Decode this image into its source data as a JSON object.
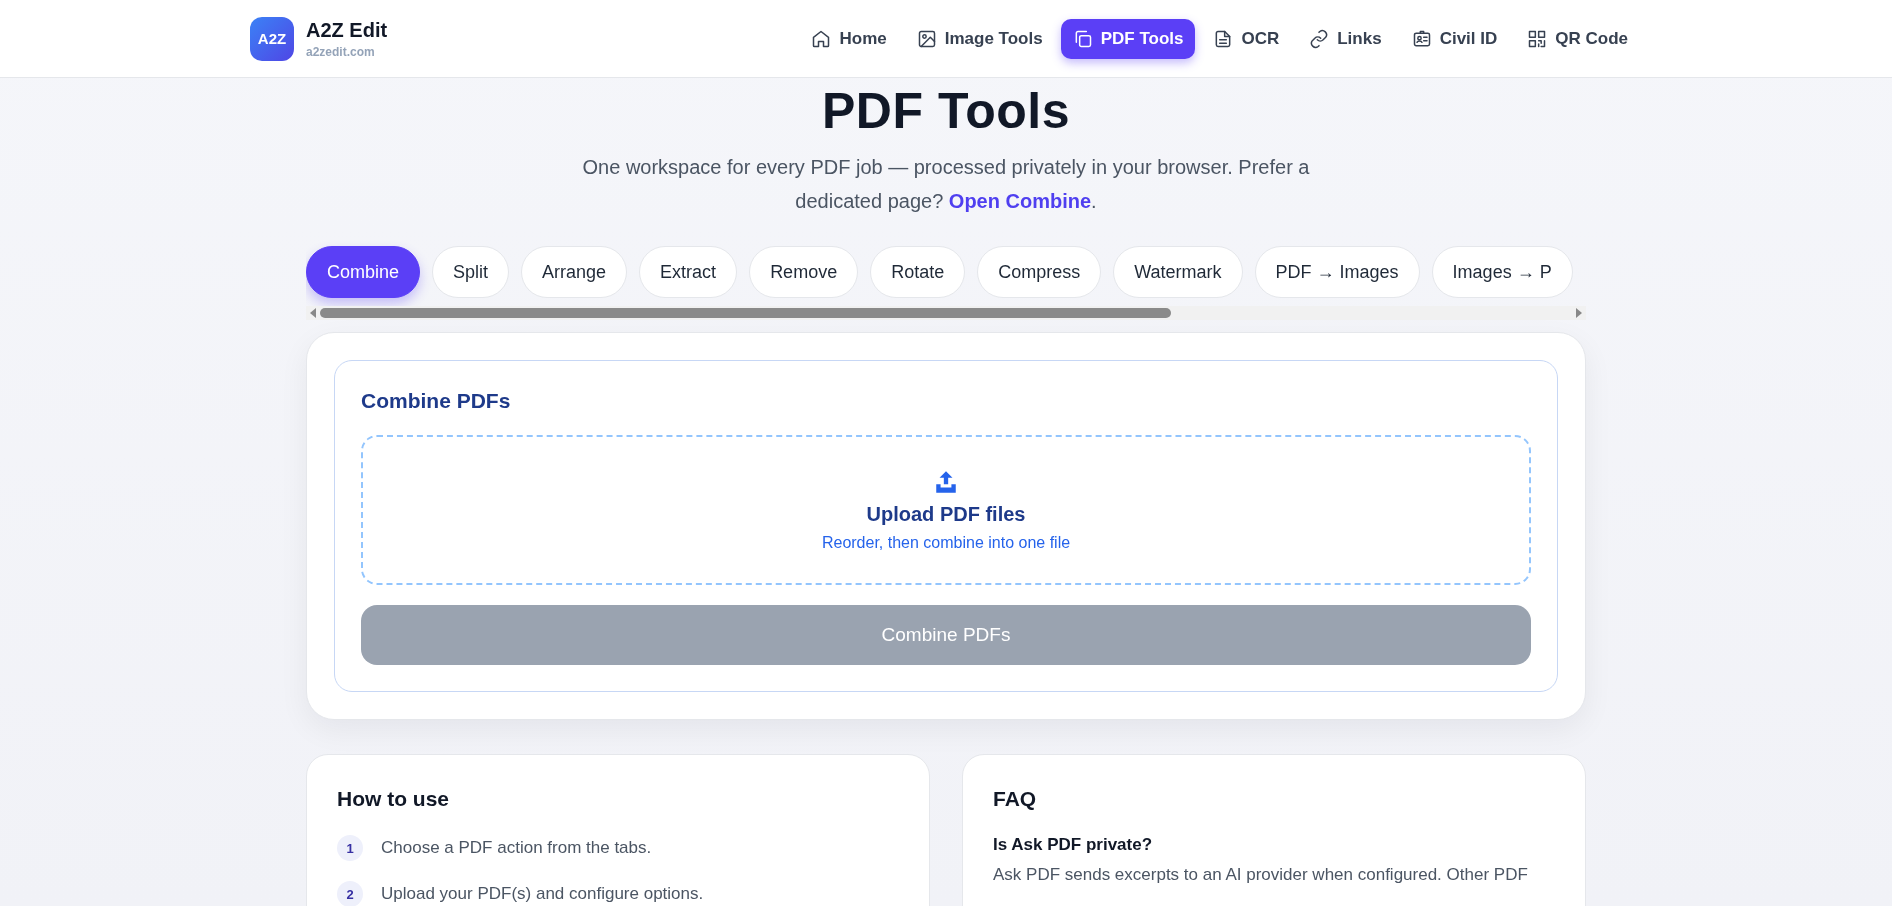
{
  "brand": {
    "name": "A2Z Edit",
    "logo": "A2Z",
    "domain": "a2zedit.com"
  },
  "nav": [
    {
      "label": "Home",
      "kind": "home",
      "selected": false
    },
    {
      "label": "Image Tools",
      "kind": "image",
      "selected": false
    },
    {
      "label": "PDF Tools",
      "kind": "copy",
      "selected": true
    },
    {
      "label": "OCR",
      "kind": "file",
      "selected": false
    },
    {
      "label": "Links",
      "kind": "link",
      "selected": false
    },
    {
      "label": "Civil ID",
      "kind": "id",
      "selected": false
    },
    {
      "label": "QR Code",
      "kind": "qr",
      "selected": false
    }
  ],
  "page": {
    "title": "PDF Tools",
    "subtitle": "One workspace for every PDF job — processed privately in your browser. Prefer a dedicated page?",
    "subtitle_link": "Open Combine",
    "subtitle_end": "."
  },
  "tabs": [
    {
      "label": "Combine",
      "selected": true
    },
    {
      "label": "Split",
      "selected": false
    },
    {
      "label": "Arrange",
      "selected": false
    },
    {
      "label": "Extract",
      "selected": false
    },
    {
      "label": "Remove",
      "selected": false
    },
    {
      "label": "Rotate",
      "selected": false
    },
    {
      "label": "Compress",
      "selected": false
    },
    {
      "label": "Watermark",
      "selected": false
    },
    {
      "label": "PDF → Images",
      "selected": false
    },
    {
      "label": "Images → P",
      "selected": false
    }
  ],
  "tool": {
    "heading": "Combine PDFs",
    "dropzone": {
      "title": "Upload PDF files",
      "hint": "Reorder, then combine into one file"
    },
    "action": {
      "label": "Combine PDFs",
      "disabled": true
    }
  },
  "how_to": {
    "title": "How to use",
    "steps": [
      {
        "number": "1",
        "text": "Choose a PDF action from the tabs."
      },
      {
        "number": "2",
        "text": "Upload your PDF(s) and configure options."
      }
    ]
  },
  "faq": {
    "title": "FAQ",
    "items": [
      {
        "question": "Is Ask PDF private?",
        "answer": "Ask PDF sends excerpts to an AI provider when configured. Other PDF"
      }
    ]
  }
}
